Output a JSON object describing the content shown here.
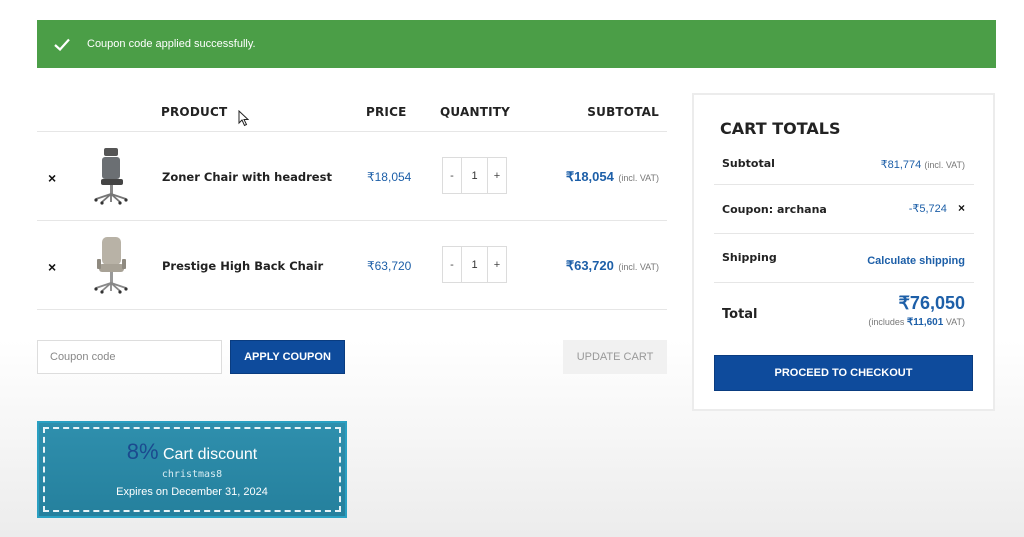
{
  "notice": {
    "message": "Coupon code applied successfully."
  },
  "table": {
    "headers": {
      "product": "PRODUCT",
      "price": "PRICE",
      "quantity": "QUANTITY",
      "subtotal": "SUBTOTAL"
    },
    "rows": [
      {
        "remove": "×",
        "name": "Zoner Chair with headrest",
        "price": "₹18,054",
        "qty_minus": "-",
        "qty": "1",
        "qty_plus": "+",
        "subtotal": "₹18,054",
        "vat": "(incl. VAT)"
      },
      {
        "remove": "×",
        "name": "Prestige High Back Chair",
        "price": "₹63,720",
        "qty_minus": "-",
        "qty": "1",
        "qty_plus": "+",
        "subtotal": "₹63,720",
        "vat": "(incl. VAT)"
      }
    ]
  },
  "coupon": {
    "placeholder": "Coupon code",
    "apply_label": "APPLY COUPON",
    "update_label": "UPDATE CART"
  },
  "promo": {
    "percent": "8%",
    "title": "Cart discount",
    "code": "christmas8",
    "expires": "Expires on December 31, 2024"
  },
  "totals": {
    "title": "CART TOTALS",
    "subtotal_label": "Subtotal",
    "subtotal_value": "₹81,774",
    "subtotal_vat": "(incl. VAT)",
    "coupon_label": "Coupon: archana",
    "coupon_value": "-₹5,724",
    "coupon_remove": "×",
    "shipping_label": "Shipping",
    "shipping_link": "Calculate shipping",
    "total_label": "Total",
    "total_value": "₹76,050",
    "includes_prefix": "(includes",
    "includes_value": "₹11,601",
    "includes_suffix": "VAT)",
    "checkout_label": "PROCEED TO CHECKOUT"
  },
  "colors": {
    "success": "#4b9e47",
    "accent": "#0e4b9c",
    "link": "#1d5fa8",
    "promo": "#2a88a6"
  },
  "icons": [
    "check-icon",
    "close-icon",
    "mouse-cursor-icon"
  ]
}
